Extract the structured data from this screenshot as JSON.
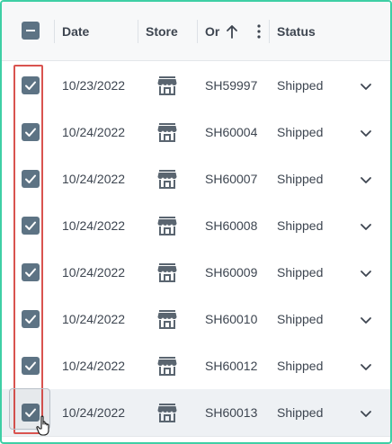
{
  "header": {
    "date_label": "Date",
    "store_label": "Store",
    "order_label": "Or",
    "status_label": "Status",
    "select_all_state": "indeterminate"
  },
  "rows": [
    {
      "date": "10/23/2022",
      "store_icon": "store-icon",
      "order": "SH59997",
      "status": "Shipped",
      "checked": true
    },
    {
      "date": "10/24/2022",
      "store_icon": "store-icon",
      "order": "SH60004",
      "status": "Shipped",
      "checked": true
    },
    {
      "date": "10/24/2022",
      "store_icon": "store-icon",
      "order": "SH60007",
      "status": "Shipped",
      "checked": true
    },
    {
      "date": "10/24/2022",
      "store_icon": "store-icon",
      "order": "SH60008",
      "status": "Shipped",
      "checked": true
    },
    {
      "date": "10/24/2022",
      "store_icon": "store-icon",
      "order": "SH60009",
      "status": "Shipped",
      "checked": true
    },
    {
      "date": "10/24/2022",
      "store_icon": "store-icon",
      "order": "SH60010",
      "status": "Shipped",
      "checked": true
    },
    {
      "date": "10/24/2022",
      "store_icon": "store-icon",
      "order": "SH60012",
      "status": "Shipped",
      "checked": true
    },
    {
      "date": "10/24/2022",
      "store_icon": "store-icon",
      "order": "SH60013",
      "status": "Shipped",
      "checked": true
    }
  ],
  "colors": {
    "frame_border": "#3ecfa5",
    "checkbox": "#5d7384",
    "selection_highlight": "#d9534f",
    "text": "#3d4550"
  }
}
